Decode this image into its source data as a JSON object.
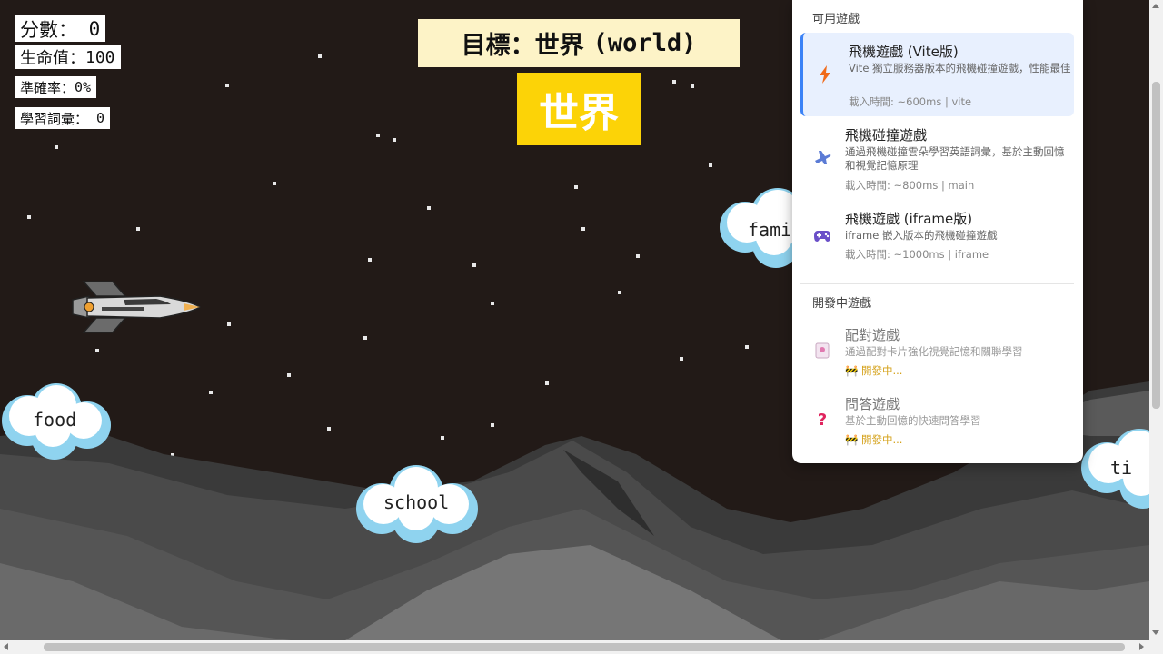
{
  "hud": {
    "score_label": "分數：",
    "score_value": "0",
    "health_label": "生命值：",
    "health_value": "100",
    "accuracy_label": "準確率：",
    "accuracy_value": "0%",
    "vocab_label": "學習詞彙：",
    "vocab_value": "0"
  },
  "target": {
    "label": "目標：",
    "word_zh": "世界",
    "word_en": "(world)",
    "display": "世界"
  },
  "clouds": [
    "food",
    "school",
    "fami",
    "ti"
  ],
  "menu": {
    "available_title": "可用遊戲",
    "available": [
      {
        "name": "飛機遊戲 (Vite版)",
        "desc": "Vite 獨立服務器版本的飛機碰撞遊戲，性能最佳",
        "meta": "載入時間: ~600ms | vite",
        "icon": "lightning-icon"
      },
      {
        "name": "飛機碰撞遊戲",
        "desc": "通過飛機碰撞雲朵學習英語詞彙，基於主動回憶和視覺記憶原理",
        "meta": "載入時間: ~800ms | main",
        "icon": "airplane-icon"
      },
      {
        "name": "飛機遊戲 (iframe版)",
        "desc": "iframe 嵌入版本的飛機碰撞遊戲",
        "meta": "載入時間: ~1000ms | iframe",
        "icon": "gamepad-icon"
      }
    ],
    "dev_title": "開發中遊戲",
    "dev": [
      {
        "name": "配對遊戲",
        "desc": "通過配對卡片強化視覺記憶和關聯學習",
        "meta": "🚧 開發中...",
        "icon": "cards-icon"
      },
      {
        "name": "問答遊戲",
        "desc": "基於主動回憶的快速問答學習",
        "meta": "🚧 開發中...",
        "icon": "question-icon"
      }
    ]
  },
  "colors": {
    "sky": "#221a17",
    "target_bg": "#fdf3c7",
    "target_word_bg": "#fcd307",
    "active_item": "#e8f0fe",
    "accent": "#3b82f6"
  }
}
